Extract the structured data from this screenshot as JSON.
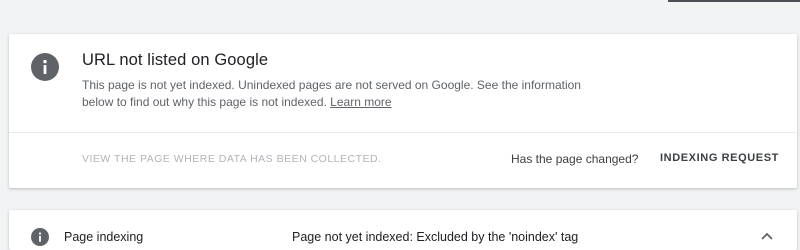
{
  "status_card": {
    "icon": "info-icon",
    "title": "URL not listed on Google",
    "description": "This page is not yet indexed. Unindexed pages are not served on Google. See the information below to find out why this page is not indexed.",
    "learn_more_label": "Learn more",
    "view_link_label": "VIEW THE PAGE WHERE DATA HAS BEEN COLLECTED.",
    "changed_question": "Has the page changed?",
    "indexing_request_label": "INDEXING REQUEST"
  },
  "indexing_row": {
    "icon": "info-icon",
    "label": "Page indexing",
    "value": "Page not yet indexed: Excluded by the 'noindex' tag",
    "expand_icon": "chevron-up-icon"
  },
  "colors": {
    "background": "#f1f3f4",
    "card": "#ffffff",
    "icon": "#5f6368",
    "text_primary": "#202124",
    "text_secondary": "#5f6368",
    "disabled_text": "#b0b4b8"
  }
}
